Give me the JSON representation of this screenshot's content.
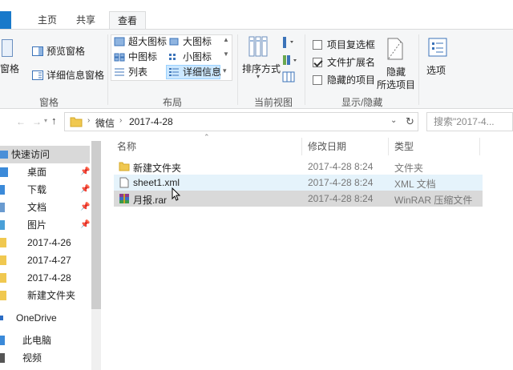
{
  "ribbon_tabs": [
    {
      "label": "主页",
      "active": false
    },
    {
      "label": "共享",
      "active": false
    },
    {
      "label": "查看",
      "active": true
    }
  ],
  "ribbon": {
    "panes": {
      "label": "窗格",
      "nav_pane_partial": "窗格",
      "preview_pane": "预览窗格",
      "details_pane": "详细信息窗格"
    },
    "layout": {
      "label": "布局",
      "items": [
        "超大图标",
        "大图标",
        "中图标",
        "小图标",
        "列表",
        "详细信息"
      ],
      "selected": "详细信息"
    },
    "current_view": {
      "label": "当前视图",
      "sort_by": "排序方式"
    },
    "show_hide": {
      "label": "显示/隐藏",
      "item_checkboxes": {
        "label": "项目复选框",
        "checked": false
      },
      "file_extensions": {
        "label": "文件扩展名",
        "checked": true
      },
      "hidden_items": {
        "label": "隐藏的项目",
        "checked": false
      },
      "hide_selected": "隐藏",
      "hide_selected_2": "所选项目",
      "options": "选项"
    }
  },
  "address": {
    "path": [
      "微信",
      "2017-4-28"
    ],
    "search_placeholder": "搜索\"2017-4..."
  },
  "nav": {
    "quick_access": "快速访问",
    "items": [
      {
        "label": "桌面",
        "pinned": true
      },
      {
        "label": "下载",
        "pinned": true
      },
      {
        "label": "文档",
        "pinned": true
      },
      {
        "label": "图片",
        "pinned": true
      },
      {
        "label": "2017-4-26",
        "pinned": false
      },
      {
        "label": "2017-4-27",
        "pinned": false
      },
      {
        "label": "2017-4-28",
        "pinned": false
      },
      {
        "label": "新建文件夹",
        "pinned": false
      }
    ],
    "onedrive": "OneDrive",
    "this_pc": "此电脑",
    "videos": "视频"
  },
  "columns": {
    "name": "名称",
    "modified": "修改日期",
    "type": "类型"
  },
  "files": [
    {
      "name": "新建文件夹",
      "modified": "2017-4-28 8:24",
      "type": "文件夹",
      "icon": "folder-icon"
    },
    {
      "name": "sheet1.xml",
      "modified": "2017-4-28 8:24",
      "type": "XML 文档",
      "icon": "xml-file-icon"
    },
    {
      "name": "月报.rar",
      "modified": "2017-4-28 8:24",
      "type": "WinRAR 压缩文件",
      "icon": "rar-file-icon"
    }
  ],
  "colors": {
    "folder": "#f0c850",
    "accent": "#1979ca",
    "hover": "#e5f3fb",
    "selected": "#d9d9d9"
  }
}
